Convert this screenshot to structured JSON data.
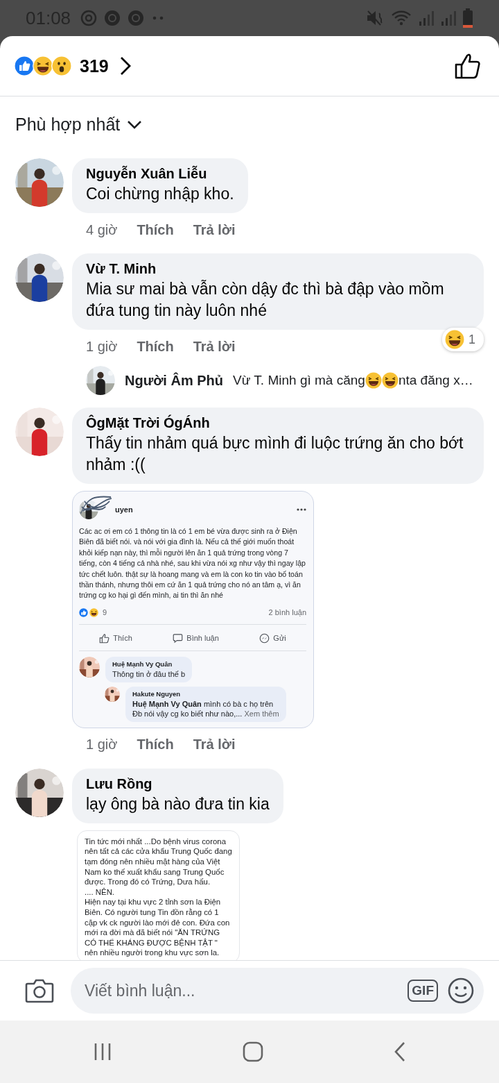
{
  "status_bar": {
    "time": "01:08"
  },
  "header": {
    "reaction_count": "319"
  },
  "sort": {
    "label": "Phù hợp nhất"
  },
  "comments": [
    {
      "author": "Nguyễn Xuân Liễu",
      "text": "Coi chừng nhập kho.",
      "time": "4 giờ",
      "like": "Thích",
      "reply": "Trả lời"
    },
    {
      "author": "Vừ T. Minh",
      "text": "Mia sư mai bà vẫn còn dậy đc thì bà đập vào mồm đứa tung tin này luôn nhé",
      "time": "1 giờ",
      "like": "Thích",
      "reply": "Trả lời",
      "reaction_count": "1",
      "reply_preview": {
        "author": "Người Âm Phủ",
        "parts": [
          {
            "kind": "text",
            "text": "Vừ T. Minh gì mà căng"
          },
          {
            "kind": "emoji"
          },
          {
            "kind": "emoji"
          },
          {
            "kind": "text",
            "text": "nta đăng x…"
          }
        ]
      }
    },
    {
      "author": "ÔgMặt Trời ÓgÁnh",
      "text": "Thấy tin nhảm quá bực mình đi luộc trứng ăn cho bớt nhảm :((",
      "time": "1 giờ",
      "like": "Thích",
      "reply": "Trả lời",
      "attachment": {
        "kind": "post_screenshot",
        "author": "uyen",
        "body": "Các ac ơi em có 1 thông tin là có 1 em bé vừa được sinh ra ở Điện Biên đã biết nói. và nói với gia đình là. Nếu cả thế giới muốn thoát khỏi kiếp nạn này, thì mỗi người lên ăn 1 quả trứng trong vòng 7 tiếng, còn 4 tiếng cả nhà nhé, sau khi vừa nói xg như vậy thì ngay lập tức chết luôn. thật sự là hoang mang và em là con ko tin vào bố toán thần thánh, nhưng thôi em cứ ăn 1 quả trứng cho nó an tâm ạ, vì ăn trứng cg ko hại gì đến mình, ai tin thì ăn nhé",
        "reaction_count": "9",
        "comment_count": "2 bình luận",
        "actions": [
          "Thích",
          "Bình luận",
          "Gửi"
        ],
        "comments": [
          {
            "author": "Huệ Mạnh Vy Quân",
            "text": "Thông tin ở đâu thế b"
          },
          {
            "author": "Hakute Nguyen",
            "text": "**Huệ Mạnh Vy Quân** mình có bà c họ trên\nĐb nói vậy cg ko biết như nào,...",
            "more": "Xem thêm"
          }
        ]
      }
    },
    {
      "author": "Lưu Rồng",
      "text": "lạy ông bà nào đưa tin kia",
      "attachment": {
        "kind": "text_image",
        "text": "Tin tức mới nhất ...Do bệnh virus corona nên tất cả các cửa khẩu Trung Quốc đang tạm đóng nên nhiều mặt hàng của Việt Nam ko thế xuất khẩu sang Trung Quốc được. Trong đó có Trứng, Dưa hấu.\n....  NÊN.\nHiện nay tại khu vực 2 tỉnh sơn la Điện Biên. Có người tung Tin đồn rằng có 1 cặp vk ck người lào mới đẻ con. Đứa con mới ra đời mà đã biết nói \"ĂN TRỨNG CÓ THỂ KHÁNG ĐƯỢC BỆNH TẬT \"\nnên nhiều người trong khu vực sơn la."
      }
    }
  ],
  "composer": {
    "placeholder": "Viết bình luận...",
    "gif": "GIF"
  }
}
